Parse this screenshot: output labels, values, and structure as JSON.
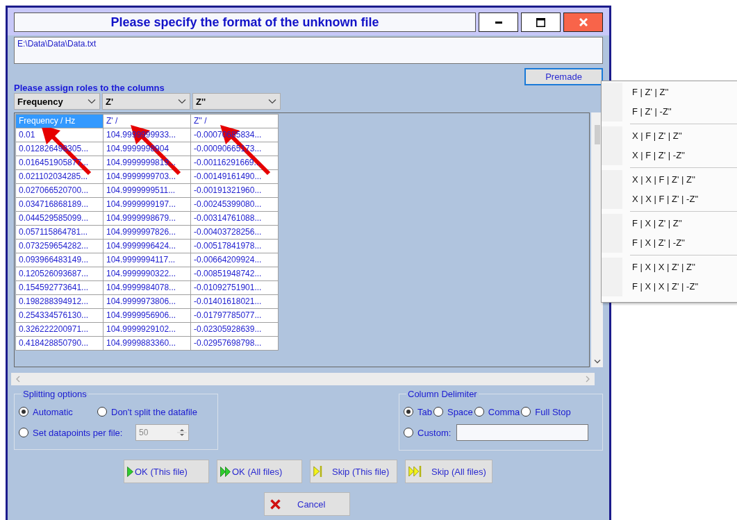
{
  "window": {
    "title": "Please specify the format of the unknown file"
  },
  "file_path": "E:\\Data\\Data\\Data.txt",
  "premade_button": "Premade",
  "assign_label": "Please assign roles to the columns",
  "role_selectors": [
    "Frequency",
    "Z'",
    "Z''"
  ],
  "table": {
    "columns": [
      {
        "label": "Frequency / Hz",
        "selected": true,
        "arrow": true
      },
      {
        "label": "Z' /",
        "selected": false,
        "arrow": true
      },
      {
        "label": "Z'' /",
        "selected": false,
        "arrow": true
      }
    ],
    "rows": [
      [
        "0.01",
        "104.9999999933...",
        "-0.00070685834..."
      ],
      [
        "0.012826498305...",
        "104.9999998904",
        "-0.00090665173..."
      ],
      [
        "0.016451905877...",
        "104.9999999819...",
        "-0.00116291669..."
      ],
      [
        "0.021102034285...",
        "104.9999999703...",
        "-0.00149161490..."
      ],
      [
        "0.027066520700...",
        "104.9999999511...",
        "-0.00191321960..."
      ],
      [
        "0.034716868189...",
        "104.9999999197...",
        "-0.00245399080..."
      ],
      [
        "0.044529585099...",
        "104.9999998679...",
        "-0.00314761088..."
      ],
      [
        "0.057115864781...",
        "104.9999997826...",
        "-0.00403728256..."
      ],
      [
        "0.073259654282...",
        "104.9999996424...",
        "-0.00517841978..."
      ],
      [
        "0.093966483149...",
        "104.9999994117...",
        "-0.00664209924..."
      ],
      [
        "0.120526093687...",
        "104.9999990322...",
        "-0.00851948742..."
      ],
      [
        "0.154592773641...",
        "104.9999984078...",
        "-0.01092751901..."
      ],
      [
        "0.198288394912...",
        "104.9999973806...",
        "-0.01401618021..."
      ],
      [
        "0.254334576130...",
        "104.9999956906...",
        "-0.01797785077..."
      ],
      [
        "0.326222200971...",
        "104.9999929102...",
        "-0.02305928639..."
      ],
      [
        "0.418428850790...",
        "104.9999883360...",
        "-0.02957698798..."
      ]
    ]
  },
  "splitting_options": {
    "title": "Splitting options",
    "options": [
      {
        "label": "Automatic",
        "selected": true
      },
      {
        "label": "Don't split the datafile",
        "selected": false
      },
      {
        "label": "Set datapoints per file:",
        "selected": false
      }
    ],
    "datapoints": {
      "value": "50",
      "disabled": true
    }
  },
  "column_delimiter": {
    "title": "Column Delimiter",
    "options": [
      {
        "label": "Tab",
        "selected": true
      },
      {
        "label": "Space",
        "selected": false
      },
      {
        "label": "Comma",
        "selected": false
      },
      {
        "label": "Full Stop",
        "selected": false
      },
      {
        "label": "Custom:",
        "selected": false
      }
    ]
  },
  "buttons": [
    {
      "label": "OK (This file)",
      "kind": "play"
    },
    {
      "label": "OK (All files)",
      "kind": "play-double"
    },
    {
      "label": "Skip (This file)",
      "kind": "skip"
    },
    {
      "label": "Skip (All files)",
      "kind": "skip-double"
    }
  ],
  "cancel_button": {
    "label": "Cancel",
    "kind": "cancel"
  },
  "premade_menu": [
    [
      "F | Z' | Z''",
      "F | Z' | -Z''"
    ],
    [
      "X | F | Z' | Z''",
      "X | F | Z' | -Z''"
    ],
    [
      "X | X | F | Z' | Z''",
      "X | X | F | Z' | -Z''"
    ],
    [
      "F | X | Z' | Z''",
      "F | X | Z' | -Z''"
    ],
    [
      "F | X | X | Z' | Z''",
      "F | X | X | Z' | -Z''"
    ]
  ]
}
